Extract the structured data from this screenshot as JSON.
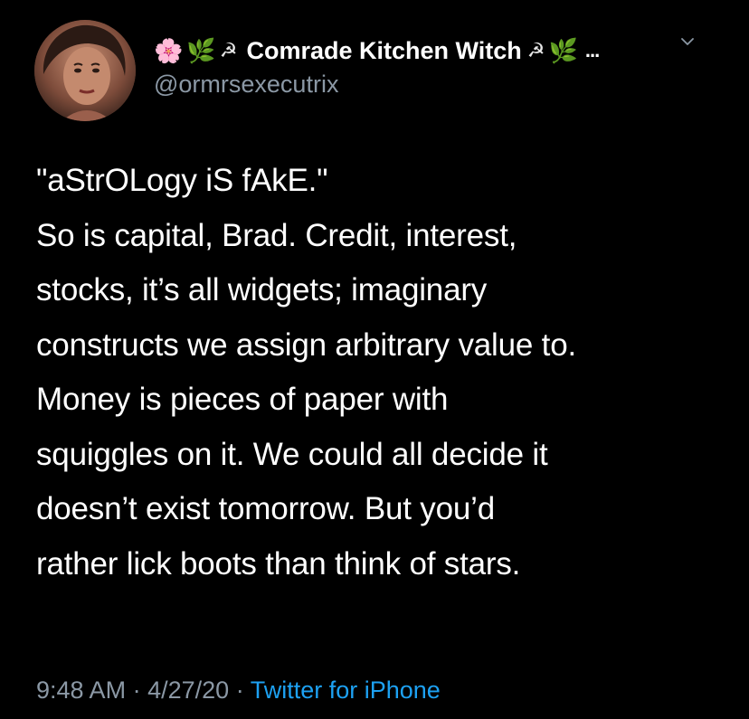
{
  "header": {
    "display_name": "Comrade Kitchen Witch",
    "name_prefix_emojis": [
      "🌸",
      "🌿",
      "☭"
    ],
    "name_suffix_emojis": [
      "☭",
      "🌿"
    ],
    "truncation": "...",
    "handle": "@ormrsexecutrix",
    "icons": {
      "avatar": "profile-photo",
      "menu": "chevron-down-icon"
    }
  },
  "tweet": {
    "lines": [
      "\"aStrOLogy iS fAkE.\"",
      "So is capital, Brad. Credit, interest,",
      "stocks, it’s all widgets; imaginary",
      "constructs we assign arbitrary value to.",
      "Money is pieces of paper with",
      "squiggles on it. We could all decide it",
      "doesn’t exist tomorrow. But you’d",
      "rather lick boots than think of stars."
    ]
  },
  "meta": {
    "time": "9:48 AM",
    "separator": "·",
    "date": "4/27/20",
    "source": "Twitter for iPhone"
  },
  "colors": {
    "background": "#000000",
    "text": "#ffffff",
    "secondary_text": "#8b98a5",
    "link": "#1da1f2"
  }
}
